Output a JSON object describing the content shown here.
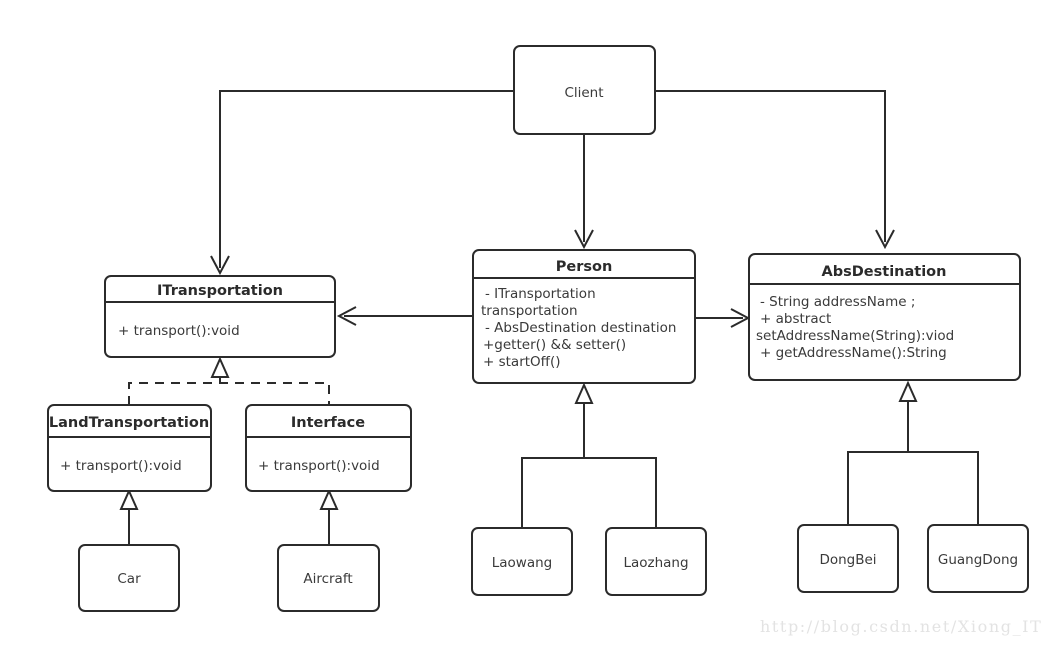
{
  "diagram": {
    "type": "uml-class-diagram",
    "watermark": "http://blog.csdn.net/Xiong_IT",
    "classes": {
      "client": {
        "name": "Client",
        "members": []
      },
      "itransportation": {
        "name": "ITransportation",
        "members": [
          "+ transport():void"
        ]
      },
      "person": {
        "name": "Person",
        "members": [
          "- ITransportation",
          "transportation",
          "- AbsDestination destination",
          "+getter() && setter()",
          "+ startOff()"
        ]
      },
      "absdestination": {
        "name": "AbsDestination",
        "members": [
          "- String addressName ;",
          "+ abstract",
          "setAddressName(String):viod",
          "+ getAddressName():String"
        ]
      },
      "landtransportation": {
        "name": "LandTransportation",
        "members": [
          "+ transport():void"
        ]
      },
      "interface": {
        "name": "Interface",
        "members": [
          "+ transport():void"
        ]
      },
      "car": {
        "name": "Car",
        "members": []
      },
      "aircraft": {
        "name": "Aircraft",
        "members": []
      },
      "laowang": {
        "name": "Laowang",
        "members": []
      },
      "laozhang": {
        "name": "Laozhang",
        "members": []
      },
      "dongbei": {
        "name": "DongBei",
        "members": []
      },
      "guangdong": {
        "name": "GuangDong",
        "members": []
      }
    },
    "relationships": [
      {
        "from": "Client",
        "to": "ITransportation",
        "kind": "dependency"
      },
      {
        "from": "Client",
        "to": "Person",
        "kind": "dependency"
      },
      {
        "from": "Client",
        "to": "AbsDestination",
        "kind": "dependency"
      },
      {
        "from": "Person",
        "to": "ITransportation",
        "kind": "association"
      },
      {
        "from": "Person",
        "to": "AbsDestination",
        "kind": "association"
      },
      {
        "from": "LandTransportation",
        "to": "ITransportation",
        "kind": "realization"
      },
      {
        "from": "Interface",
        "to": "ITransportation",
        "kind": "realization"
      },
      {
        "from": "Car",
        "to": "LandTransportation",
        "kind": "generalization"
      },
      {
        "from": "Aircraft",
        "to": "Interface",
        "kind": "generalization"
      },
      {
        "from": "Laowang",
        "to": "Person",
        "kind": "generalization"
      },
      {
        "from": "Laozhang",
        "to": "Person",
        "kind": "generalization"
      },
      {
        "from": "DongBei",
        "to": "AbsDestination",
        "kind": "generalization"
      },
      {
        "from": "GuangDong",
        "to": "AbsDestination",
        "kind": "generalization"
      }
    ],
    "colors": {
      "stroke": "#2b2b2b",
      "fill": "#ffffff",
      "text": "#3a3a3a",
      "watermark": "#e3e3e3"
    }
  }
}
